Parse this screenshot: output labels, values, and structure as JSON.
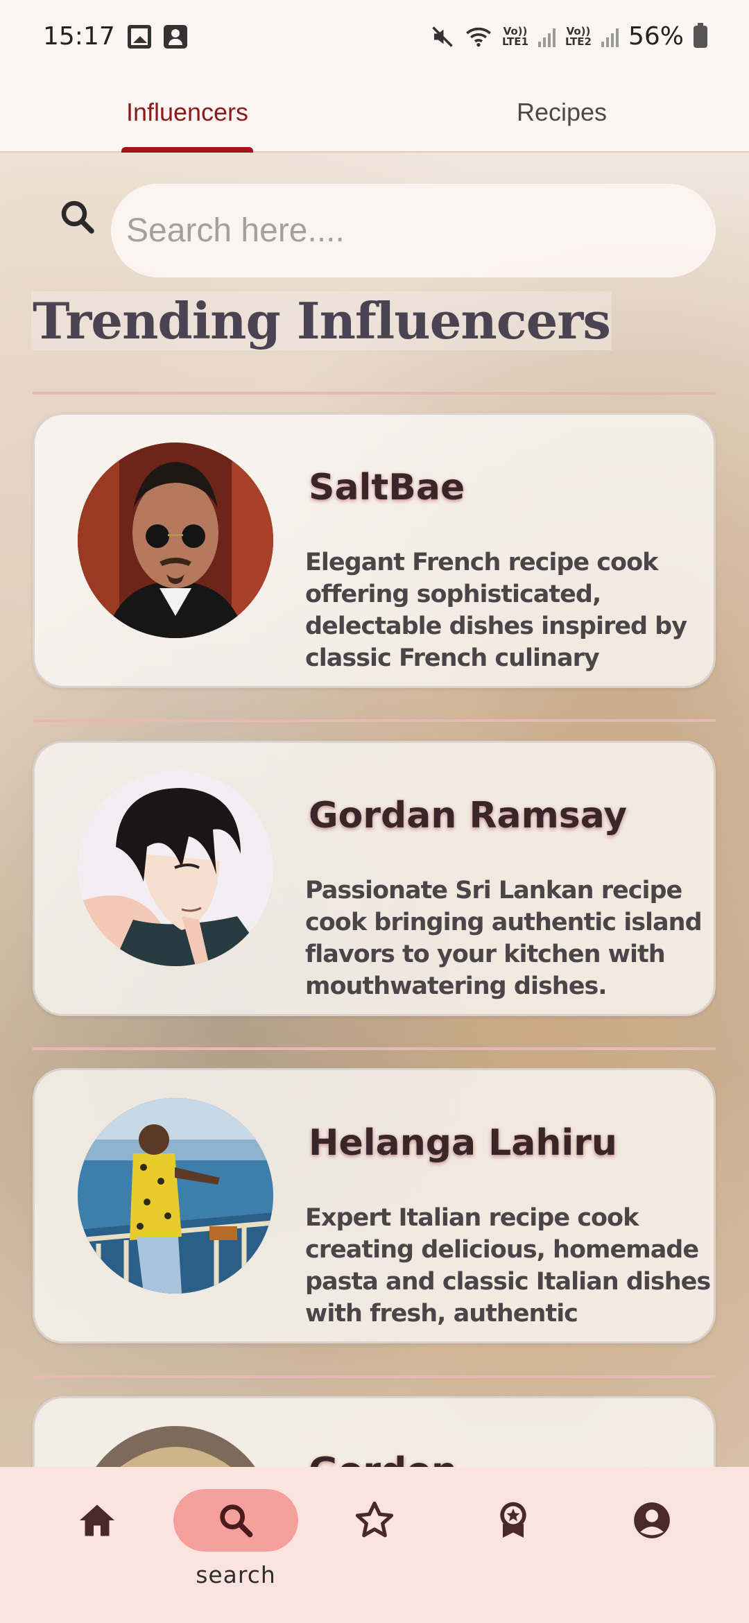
{
  "status_bar": {
    "time": "15:17",
    "battery": "56%",
    "sim1": "LTE1",
    "sim2": "LTE2",
    "volte": "Vo))"
  },
  "tabs": [
    {
      "label": "Influencers",
      "active": true
    },
    {
      "label": "Recipes",
      "active": false
    }
  ],
  "search": {
    "placeholder": "Search here...."
  },
  "section_title": "Trending Influencers",
  "influencers": [
    {
      "name": "SaltBae",
      "description": "Elegant French recipe cook offering sophisticated, delectable dishes inspired by classic French culinary techniques."
    },
    {
      "name": "Gordan Ramsay",
      "description": "Passionate Sri Lankan recipe cook bringing authentic island flavors to your kitchen with mouthwatering dishes."
    },
    {
      "name": "Helanga Lahiru",
      "description": "Expert Italian recipe cook creating delicious, homemade pasta and classic Italian dishes with fresh, authentic ingredients."
    },
    {
      "name": "Gordon",
      "description": ""
    }
  ],
  "bottom_nav": [
    {
      "icon": "home-icon",
      "label": ""
    },
    {
      "icon": "search-icon",
      "label": "search",
      "active": true
    },
    {
      "icon": "star-icon",
      "label": ""
    },
    {
      "icon": "award-icon",
      "label": ""
    },
    {
      "icon": "account-icon",
      "label": ""
    }
  ],
  "colors": {
    "accent": "#a3111b",
    "active_nav_pill": "#f5a09c",
    "nav_background": "#fbe3e0",
    "divider": "#e6b9b6"
  }
}
